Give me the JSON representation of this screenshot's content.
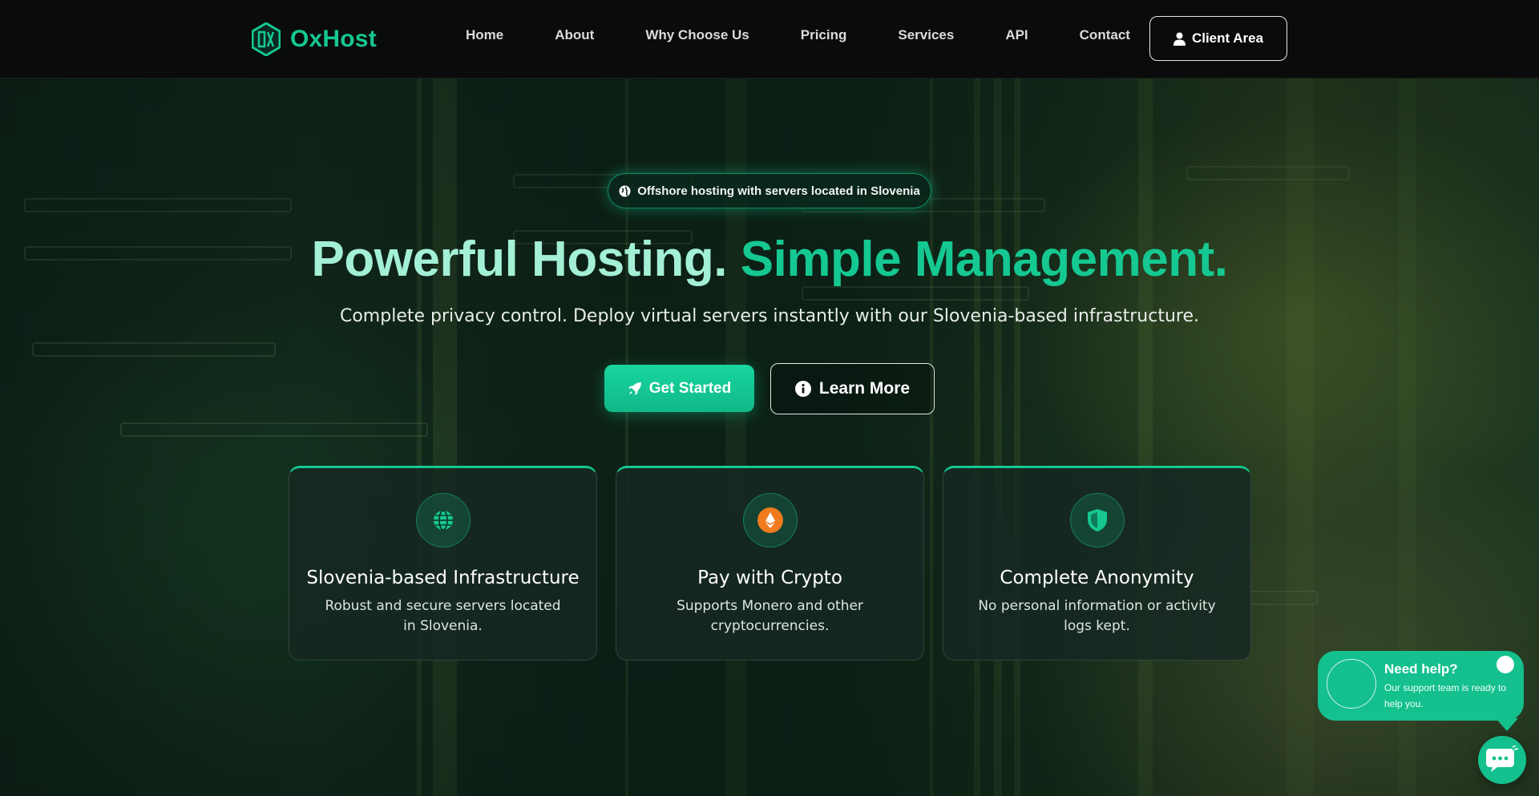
{
  "brand": {
    "name": "OxHost",
    "color": "#15c891"
  },
  "nav": {
    "links": [
      "Home",
      "About",
      "Why Choose Us",
      "Pricing",
      "Services",
      "API",
      "Contact"
    ],
    "client_area": "Client Area"
  },
  "hero": {
    "badge": "Offshore hosting with servers located in Slovenia",
    "title_part1": "Powerful Hosting. ",
    "title_part2": "Simple Management.",
    "subtitle": "Complete privacy control. Deploy virtual servers instantly with our Slovenia-based infrastructure.",
    "primary_button": "Get Started",
    "secondary_button": "Learn More"
  },
  "features": [
    {
      "icon": "globe-icon",
      "title": "Slovenia-based Infrastructure",
      "description": "Robust and secure servers located in Slovenia."
    },
    {
      "icon": "crypto-coin-icon",
      "title": "Pay with Crypto",
      "description": "Supports Monero and other cryptocurrencies."
    },
    {
      "icon": "shield-icon",
      "title": "Complete Anonymity",
      "description": "No personal information or activity logs kept."
    }
  ],
  "help_widget": {
    "title": "Need help?",
    "text": "Our support team is ready to help you."
  },
  "colors": {
    "accent": "#15c891",
    "title_light": "#a3f0d6",
    "crypto_orange": "#f07a1e",
    "nav_bg": "#0a0b0b"
  }
}
